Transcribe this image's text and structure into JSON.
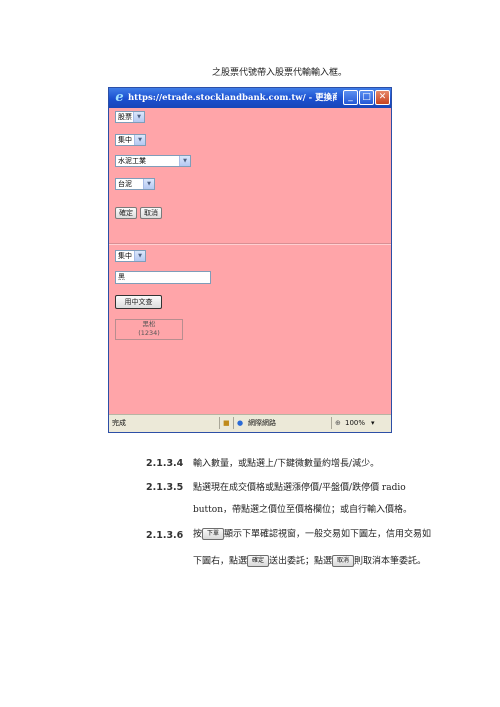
{
  "intro_line": "之股票代號帶入股票代輸輸入框。",
  "browser": {
    "title": "https://etrade.stocklandbank.com.tw/ - 更換商品 - Windows ...",
    "minimize_glyph": "_",
    "maximize_glyph": "□",
    "close_glyph": "✕",
    "panel_top": {
      "market_select": "股票",
      "board_select": "集中",
      "industry_select": "水泥工業",
      "stock_select": "台泥",
      "confirm_label": "確定",
      "cancel_label": "取消"
    },
    "panel_bottom": {
      "board_select": "集中",
      "search_value": "黑",
      "search_button": "用中文查",
      "result_name": "黑松",
      "result_code": "(1234)"
    },
    "status": {
      "text": "完成",
      "zone": "網際網路",
      "zoom": "100%",
      "zoom_arrow": "▾"
    }
  },
  "sections": [
    {
      "num": "2.1.3.4",
      "text": "輸入數量，或點選上/下鍵微數量約增長/減少。"
    },
    {
      "num": "2.1.3.5",
      "text": "點選現在成交價格或點選漲停價/平盤價/跌停價 radio",
      "text2": "button，帶點選之價位至價格欄位；或自行輸入價格。"
    },
    {
      "num": "2.1.3.6",
      "text_a": "按",
      "btn_a": "下單",
      "text_b": "顯示下單確認視窗，一般交易如下圖左，信用交易如",
      "text_c": "下圖右，點選",
      "btn_b": "確定",
      "text_d": "送出委託；點選",
      "btn_c": "取消",
      "text_e": "則取消本筆委託。"
    }
  ],
  "colors": {
    "page_bg": "#ffa5a9",
    "titlebar": "#1b4fcf"
  }
}
